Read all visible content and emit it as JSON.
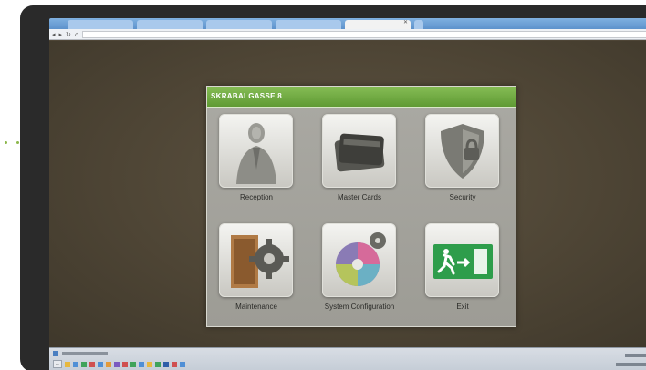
{
  "app": {
    "title": "SKRABALGASSE 8",
    "tiles": [
      {
        "label": "Reception",
        "icon": "reception-icon"
      },
      {
        "label": "Master Cards",
        "icon": "master-cards-icon"
      },
      {
        "label": "Security",
        "icon": "security-shield-icon"
      },
      {
        "label": "Maintenance",
        "icon": "maintenance-icon"
      },
      {
        "label": "System Configuration",
        "icon": "system-configuration-icon"
      },
      {
        "label": "Exit",
        "icon": "exit-sign-icon"
      }
    ]
  },
  "colors": {
    "title_bar": "#6fac42",
    "desktop": "#4e4535",
    "decor_dots": "#8cb74a",
    "exit_sign": "#2e9d4b"
  }
}
